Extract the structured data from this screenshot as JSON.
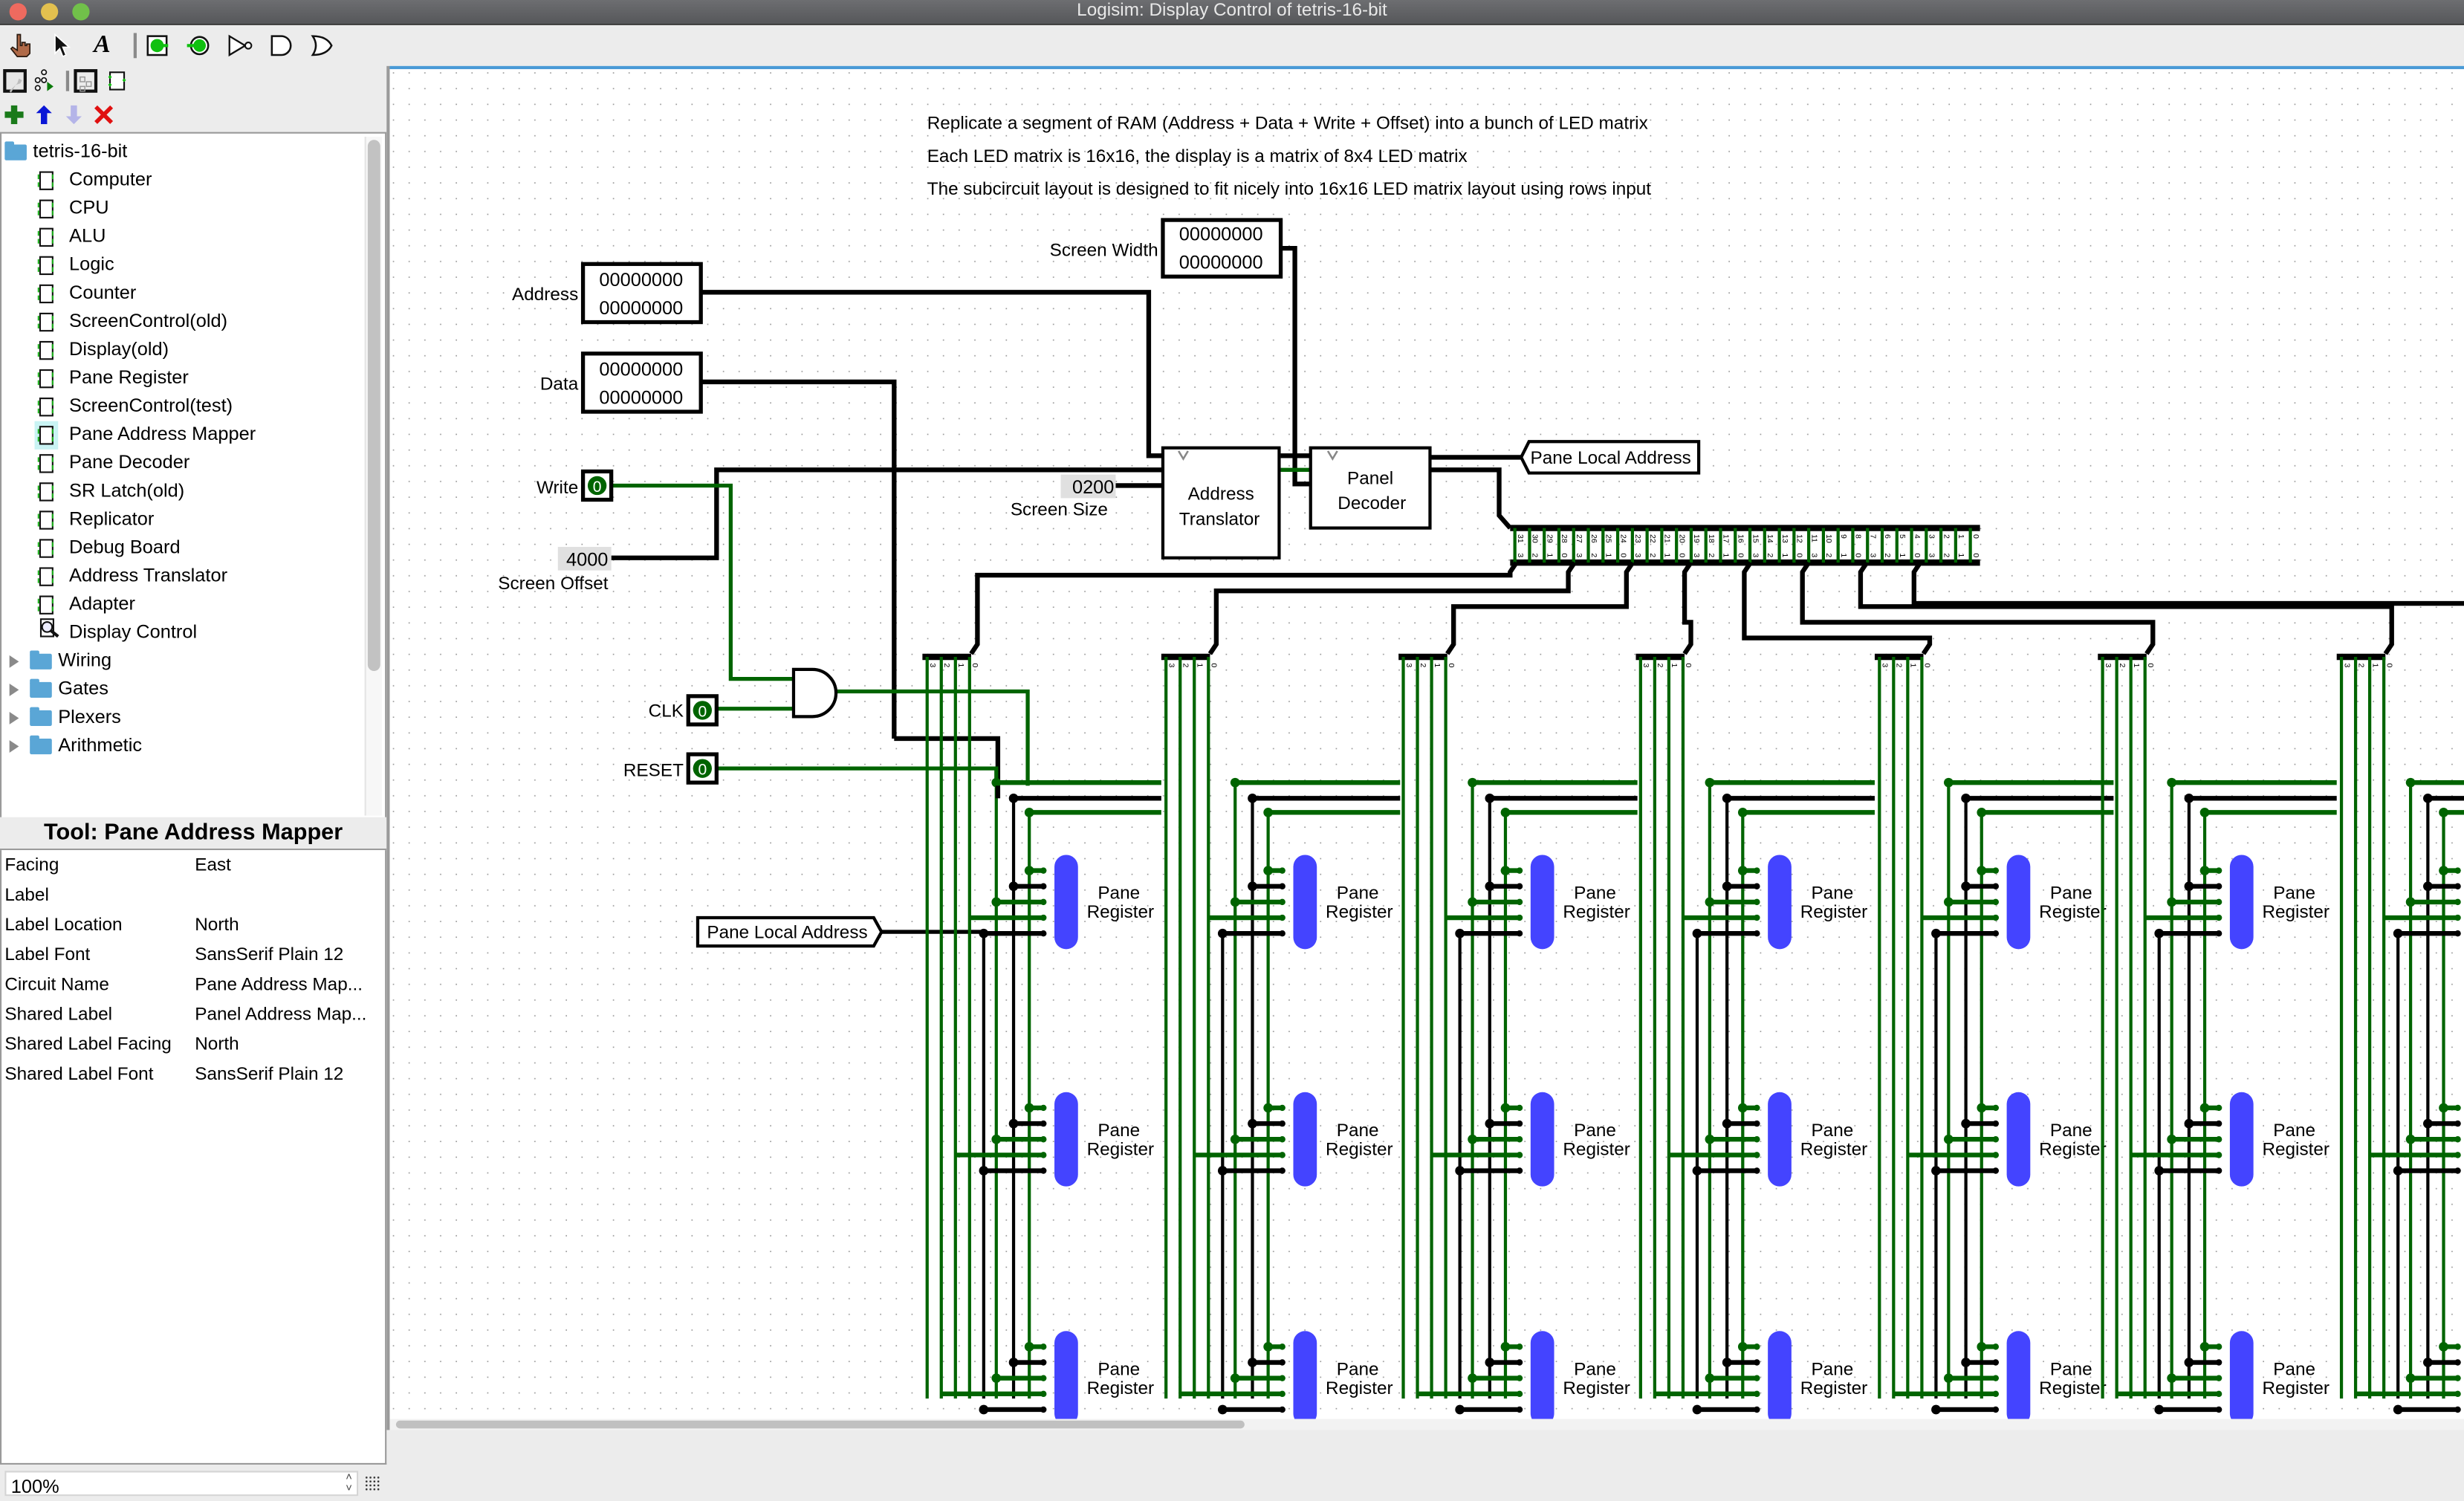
{
  "window": {
    "title": "Logisim: Display Control of tetris-16-bit",
    "traffic_lights": {
      "close": "#ee6a5f",
      "minimize": "#e3c04f",
      "maximize": "#71c04a"
    }
  },
  "toolbar": {
    "tools": [
      {
        "name": "poke-tool-icon",
        "label": "Poke"
      },
      {
        "name": "select-tool-icon",
        "label": "Select"
      },
      {
        "name": "text-tool-icon",
        "label": "A"
      },
      {
        "name": "input-pin-icon",
        "label": "Input Pin"
      },
      {
        "name": "output-pin-icon",
        "label": "Output Pin"
      },
      {
        "name": "not-gate-icon",
        "label": "NOT Gate"
      },
      {
        "name": "and-gate-icon",
        "label": "AND Gate"
      },
      {
        "name": "or-gate-icon",
        "label": "OR Gate"
      }
    ]
  },
  "explorer": {
    "project_name": "tetris-16-bit",
    "circuits": [
      "Computer",
      "CPU",
      "ALU",
      "Logic",
      "Counter",
      "ScreenControl(old)",
      "Display(old)",
      "Pane Register",
      "ScreenControl(test)",
      "Pane Address Mapper",
      "Pane Decoder",
      "SR Latch(old)",
      "Replicator",
      "Debug Board",
      "Address Translator",
      "Adapter",
      "Display Control"
    ],
    "selected_tool": "Pane Address Mapper",
    "current_circuit": "Display Control",
    "libraries": [
      "Wiring",
      "Gates",
      "Plexers",
      "Arithmetic"
    ]
  },
  "attributes": {
    "header": "Tool: Pane Address Mapper",
    "rows": [
      {
        "key": "Facing",
        "value": "East"
      },
      {
        "key": "Label",
        "value": ""
      },
      {
        "key": "Label Location",
        "value": "North"
      },
      {
        "key": "Label Font",
        "value": "SansSerif Plain 12"
      },
      {
        "key": "Circuit Name",
        "value": "Pane Address Map..."
      },
      {
        "key": "Shared Label",
        "value": "Panel Address Map..."
      },
      {
        "key": "Shared Label Facing",
        "value": "North"
      },
      {
        "key": "Shared Label Font",
        "value": "SansSerif Plain 12"
      }
    ]
  },
  "zoom": {
    "value": "100%"
  },
  "canvas": {
    "notes": [
      "Replicate a segment of RAM (Address + Data + Write + Offset) into a bunch of LED matrix",
      "Each LED matrix is 16x16, the display is a matrix of 8x4 LED matrix",
      "The subcircuit layout is designed to fit nicely into 16x16 LED matrix layout using rows input"
    ],
    "pins": {
      "address": {
        "label": "Address",
        "value_hi": "00000000",
        "value_lo": "00000000"
      },
      "data": {
        "label": "Data",
        "value_hi": "00000000",
        "value_lo": "00000000"
      },
      "screen_width": {
        "label": "Screen Width",
        "value_hi": "00000000",
        "value_lo": "00000000"
      },
      "write": {
        "label": "Write",
        "value": "0"
      },
      "clk": {
        "label": "CLK",
        "value": "0"
      },
      "reset": {
        "label": "RESET",
        "value": "0"
      }
    },
    "constants": {
      "screen_offset": {
        "label": "Screen Offset",
        "value": "4000"
      },
      "screen_size": {
        "label": "Screen Size",
        "value": "0200"
      }
    },
    "components": {
      "address_translator": "Address\nTranslator",
      "panel_decoder": "Panel\nDecoder",
      "pane_register_label_1": "Pane",
      "pane_register_label_2": "Register"
    },
    "tunnels": {
      "pane_local_address_out": "Pane Local Address",
      "pane_local_address_in": "Pane Local Address"
    },
    "splitter_bits_top": [
      "31",
      "30",
      "29",
      "28",
      "27",
      "26",
      "25",
      "24",
      "23",
      "22",
      "21",
      "20",
      "19",
      "18",
      "17",
      "16",
      "15",
      "14",
      "13",
      "12",
      "11",
      "10",
      "9",
      "8",
      "7",
      "6",
      "5",
      "4",
      "3",
      "2",
      "1",
      "0"
    ],
    "splitter_bits_bottom": [
      "3",
      "2",
      "1",
      "0"
    ],
    "colors": {
      "wire_on": "#006400",
      "wire_bus": "#000000",
      "pane_register": "#4444ff",
      "grid_dot": "#9a9a9a"
    }
  }
}
